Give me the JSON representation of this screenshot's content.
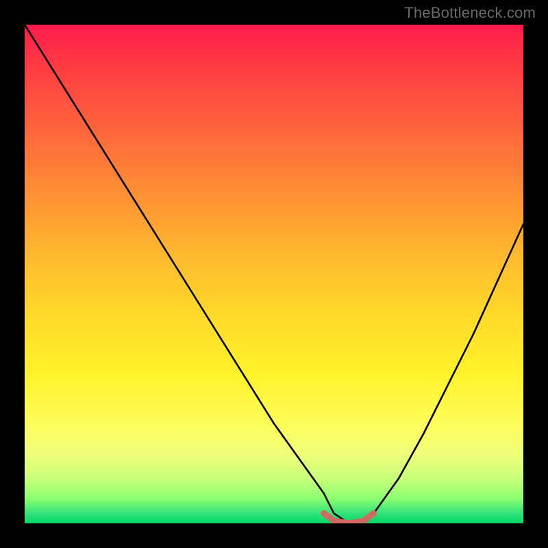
{
  "watermark": "TheBottleneck.com",
  "chart_data": {
    "type": "line",
    "title": "",
    "xlabel": "",
    "ylabel": "",
    "xlim": [
      0,
      100
    ],
    "ylim": [
      0,
      100
    ],
    "grid": false,
    "background_gradient": "red-yellow-green vertical",
    "series": [
      {
        "name": "bottleneck-curve",
        "color": "#000000",
        "x": [
          0,
          5,
          10,
          15,
          20,
          25,
          30,
          35,
          40,
          45,
          50,
          55,
          60,
          62,
          65,
          68,
          70,
          75,
          80,
          85,
          90,
          95,
          100
        ],
        "y": [
          100,
          92,
          84,
          76,
          68,
          60,
          52,
          44,
          36,
          28,
          20,
          13,
          6,
          2,
          0,
          0,
          2,
          9,
          18,
          28,
          38,
          49,
          60
        ]
      },
      {
        "name": "optimal-segment",
        "color": "#d46060",
        "x": [
          60,
          62,
          65,
          68,
          70
        ],
        "y": [
          2,
          0.5,
          0,
          0.5,
          2
        ]
      }
    ],
    "annotations": []
  }
}
